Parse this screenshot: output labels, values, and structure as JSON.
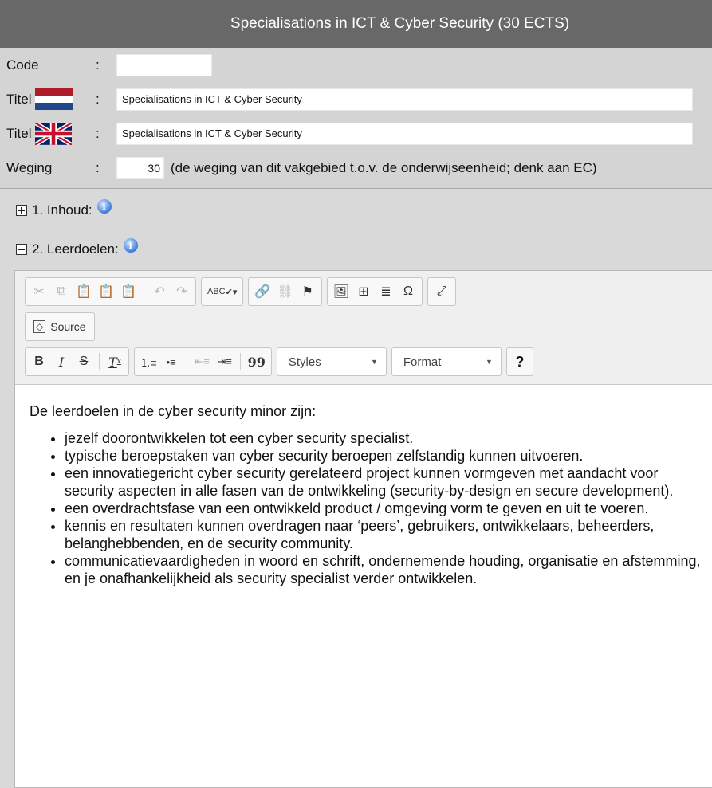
{
  "header": {
    "title": "Specialisations in ICT & Cyber Security (30 ECTS)"
  },
  "form": {
    "code": {
      "label": "Code",
      "value": ""
    },
    "titel_nl": {
      "label": "Titel",
      "value": "Specialisations in ICT & Cyber Security",
      "flag": "flag-netherlands-icon"
    },
    "titel_en": {
      "label": "Titel",
      "value": "Specialisations in ICT & Cyber Security",
      "flag": "flag-uk-icon"
    },
    "weging": {
      "label": "Weging",
      "value": "30",
      "note": "(de weging van dit vakgebied t.o.v. de onderwijseenheid; denk aan EC)"
    },
    "colon": ":"
  },
  "sections": [
    {
      "label": "1. Inhoud:",
      "state": "collapsed"
    },
    {
      "label": "2. Leerdoelen:",
      "state": "expanded"
    }
  ],
  "toolbar": {
    "source_label": "Source",
    "bold": "B",
    "italic": "I",
    "strike": "S",
    "clear": "T",
    "blockquote": "99",
    "styles_label": "Styles",
    "format_label": "Format",
    "help_label": "?",
    "special_char": "Ω",
    "spell": "ABC"
  },
  "content": {
    "intro": "De leerdoelen in de cyber security minor zijn:",
    "items": [
      "jezelf doorontwikkelen tot een cyber security specialist.",
      "typische beroepstaken van cyber security beroepen zelfstandig kunnen uitvoeren.",
      "een innovatiegericht cyber security gerelateerd project kunnen vormgeven met aandacht voor security aspecten in alle fasen van de ontwikkeling (security-by-design en secure development).",
      "een overdrachtsfase van een ontwikkeld product / omgeving vorm te geven en uit te voeren.",
      "kennis en resultaten kunnen overdragen naar ‘peers’, gebruikers, ontwikkelaars, beheerders, belanghebbenden, en de security community.",
      "communicatievaardigheden in woord en schrift, ondernemende houding, organisatie en afstemming, en je onafhankelijkheid als security specialist verder ontwikkelen."
    ]
  },
  "colors": {
    "header_bg": "#686868",
    "form_bg": "#d4d4d4",
    "info_blue": "#3d7ad8"
  }
}
